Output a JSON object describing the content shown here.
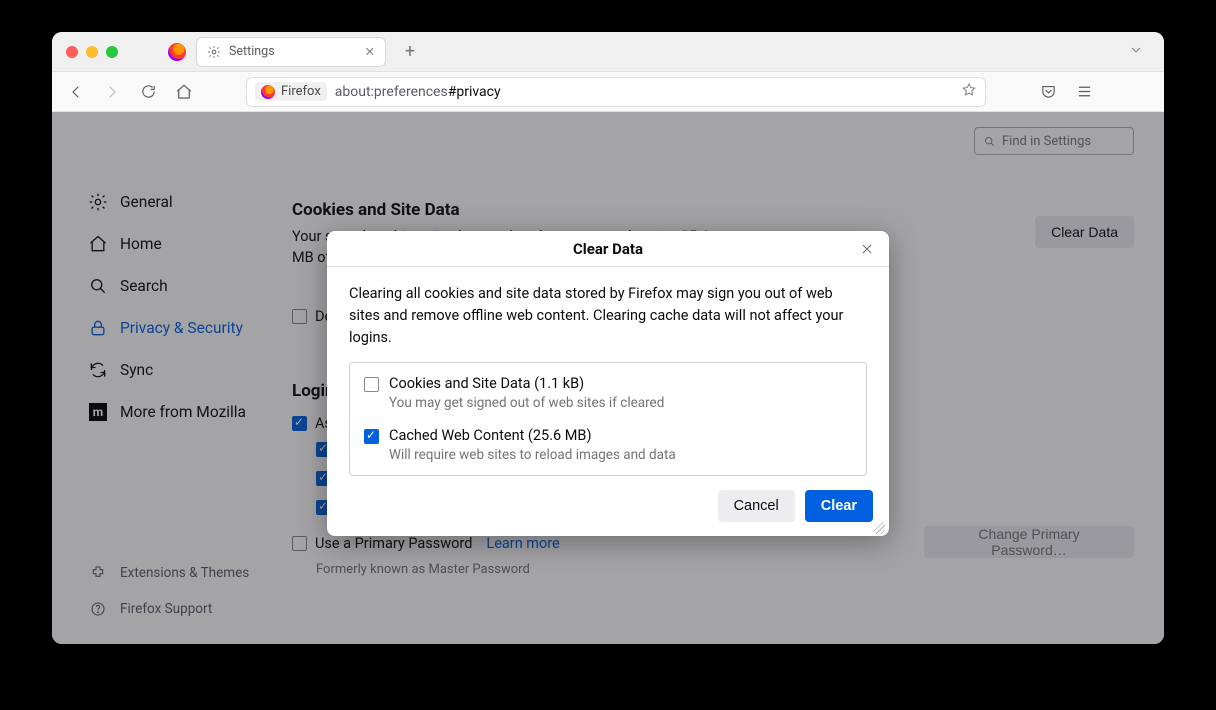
{
  "tab": {
    "title": "Settings"
  },
  "urlbar": {
    "identity_label": "Firefox",
    "url_prefix": "about:preferences",
    "url_suffix": "#privacy"
  },
  "search": {
    "placeholder": "Find in Settings"
  },
  "sidebar": {
    "items": [
      {
        "label": "General"
      },
      {
        "label": "Home"
      },
      {
        "label": "Search"
      },
      {
        "label": "Privacy & Security"
      },
      {
        "label": "Sync"
      },
      {
        "label": "More from Mozilla"
      }
    ],
    "footer": [
      {
        "label": "Extensions & Themes"
      },
      {
        "label": "Firefox Support"
      }
    ]
  },
  "cookies": {
    "title": "Cookies and Site Data",
    "desc": "Your stored cookies, site data, and cache are currently using 25.6 MB of disk space.",
    "clear_btn": "Clear Data",
    "delete_label": "Delete cookies and site data when Firefox is closed"
  },
  "logins": {
    "title": "Logins and Passwords",
    "ask_label": "Ask to save logins and passwords for websites",
    "use_primary": "Use a Primary Password",
    "learn_more": "Learn more",
    "change_btn": "Change Primary Password…",
    "formerly": "Formerly known as Master Password"
  },
  "dialog": {
    "title": "Clear Data",
    "desc": "Clearing all cookies and site data stored by Firefox may sign you out of web sites and remove offline web content. Clearing cache data will not affect your logins.",
    "opt1_label": "Cookies and Site Data (1.1 kB)",
    "opt1_sub": "You may get signed out of web sites if cleared",
    "opt2_label": "Cached Web Content (25.6 MB)",
    "opt2_sub": "Will require web sites to reload images and data",
    "cancel": "Cancel",
    "clear": "Clear"
  }
}
